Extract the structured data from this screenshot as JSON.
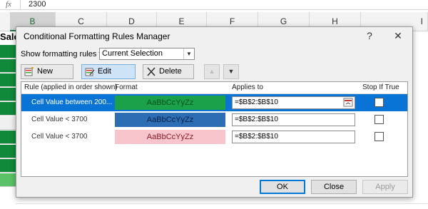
{
  "formula_bar": {
    "fx_label": "fx",
    "value": "2300"
  },
  "columns": [
    {
      "letter": "B",
      "selected": true
    },
    {
      "letter": "C",
      "selected": false
    },
    {
      "letter": "D",
      "selected": false
    },
    {
      "letter": "E",
      "selected": false
    },
    {
      "letter": "F",
      "selected": false
    },
    {
      "letter": "G",
      "selected": false
    },
    {
      "letter": "H",
      "selected": false
    },
    {
      "letter": "I",
      "selected": false
    }
  ],
  "sheet_text": {
    "header_fragment": "Sale"
  },
  "dialog": {
    "title": "Conditional Formatting Rules Manager",
    "help_glyph": "?",
    "close_glyph": "✕",
    "show_rules_label": "Show formatting rules for:",
    "show_rules_value": "Current Selection",
    "toolbar": {
      "new_rule": "New Rule...",
      "edit_rule": "Edit Rule...",
      "delete_rule": "Delete Rule"
    },
    "table_headers": {
      "rule": "Rule (applied in order shown)",
      "format": "Format",
      "applies_to": "Applies to",
      "stop_if_true": "Stop If True"
    },
    "rules": [
      {
        "rule": "Cell Value between 200...",
        "format_preview": "AaBbCcYyZz",
        "format_bg": "#1aa14a",
        "format_fg": "#0b4f1f",
        "applies_to": "=$B$2:$B$10",
        "stop_if_true": false,
        "selected": true
      },
      {
        "rule": "Cell Value < 3700",
        "format_preview": "AaBbCcYyZz",
        "format_bg": "#2c6db3",
        "format_fg": "#0b1f4a",
        "applies_to": "=$B$2:$B$10",
        "stop_if_true": false,
        "selected": false
      },
      {
        "rule": "Cell Value < 3700",
        "format_preview": "AaBbCcYyZz",
        "format_bg": "#f7c5cb",
        "format_fg": "#8a1a2a",
        "applies_to": "=$B$2:$B$10",
        "stop_if_true": false,
        "selected": false
      }
    ],
    "buttons": {
      "ok": "OK",
      "close": "Close",
      "apply": "Apply"
    }
  }
}
